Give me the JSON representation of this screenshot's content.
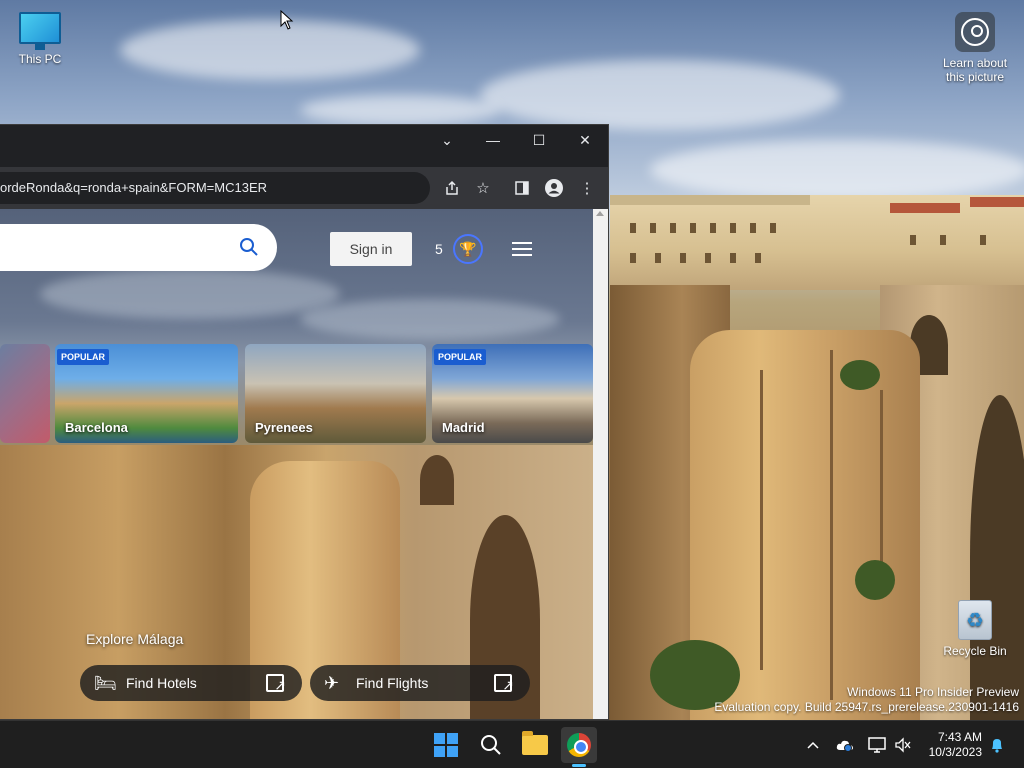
{
  "desktop": {
    "icons": [
      {
        "label": "This PC"
      },
      {
        "label": "Learn about this picture"
      },
      {
        "label": "Recycle Bin"
      }
    ],
    "watermark": {
      "line1": "Windows 11 Pro Insider Preview",
      "line2": "Evaluation copy. Build 25947.rs_prerelease.230901-1416"
    }
  },
  "browser": {
    "window_controls": {
      "dropdown": "⌄",
      "minimize": "—",
      "maximize": "☐",
      "close": "✕"
    },
    "address_bar": {
      "url": "ordeRonda&q=ronda+spain&FORM=MC13ER"
    },
    "toolbar_icons": [
      "share-icon",
      "bookmark-star-icon",
      "side-panel-icon",
      "profile-icon",
      "more-menu-icon"
    ],
    "page": {
      "search_placeholder": "",
      "sign_in": "Sign in",
      "points": "5",
      "cards": [
        {
          "label": "",
          "badge": ""
        },
        {
          "label": "Barcelona",
          "badge": "POPULAR"
        },
        {
          "label": "Pyrenees",
          "badge": ""
        },
        {
          "label": "Madrid",
          "badge": "POPULAR"
        }
      ],
      "explore_title": "Explore Málaga",
      "actions": [
        {
          "label": "Find Hotels",
          "icon": "bed-icon"
        },
        {
          "label": "Find Flights",
          "icon": "plane-icon"
        }
      ]
    }
  },
  "taskbar": {
    "apps": [
      "start-icon",
      "search-icon",
      "file-explorer-icon",
      "chrome-icon"
    ],
    "tray_icons": [
      "chevron-up-icon",
      "onedrive-icon",
      "network-icon",
      "volume-muted-icon"
    ],
    "time": "7:43 AM",
    "date": "10/3/2023",
    "notification_icon": "bell-icon"
  },
  "colors": {
    "taskbar": "#1f1f1f",
    "browser_chrome": "#202124",
    "toolbar": "#35363a",
    "badge": "#1a5dd0",
    "accent": "#4cc2ff"
  }
}
